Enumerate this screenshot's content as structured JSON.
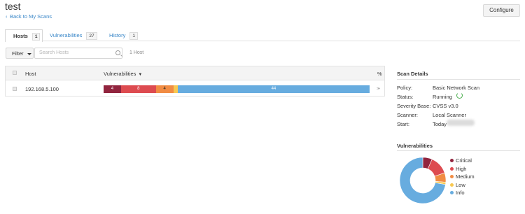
{
  "header": {
    "title": "test",
    "back_link": "Back to My Scans",
    "configure_label": "Configure"
  },
  "tabs": [
    {
      "label": "Hosts",
      "count": "1"
    },
    {
      "label": "Vulnerabilities",
      "count": "27"
    },
    {
      "label": "History",
      "count": "1"
    }
  ],
  "toolbar": {
    "filter_label": "Filter",
    "search_placeholder": "Search Hosts",
    "host_count": "1 Host"
  },
  "table": {
    "columns": {
      "host": "Host",
      "vulnerabilities": "Vulnerabilities",
      "percent": "%"
    },
    "sort_indicator": "▼",
    "rows": [
      {
        "host": "192.168.5.100",
        "action": "≫",
        "counts": [
          {
            "severity": "Critical",
            "value": 4,
            "label": "4",
            "color": "#91243e"
          },
          {
            "severity": "High",
            "value": 8,
            "label": "8",
            "color": "#dd4b50"
          },
          {
            "severity": "Medium",
            "value": 4,
            "label": "4",
            "color": "#f18c43"
          },
          {
            "severity": "Low",
            "value": 1,
            "label": "",
            "color": "#f8c851"
          },
          {
            "severity": "Info",
            "value": 44,
            "label": "44",
            "color": "#67acdf"
          }
        ]
      }
    ]
  },
  "scan_details": {
    "title": "Scan Details",
    "rows": [
      {
        "label": "Policy:",
        "value": "Basic Network Scan"
      },
      {
        "label": "Status:",
        "value": "Running"
      },
      {
        "label": "Severity Base:",
        "value": "CVSS v3.0"
      },
      {
        "label": "Scanner:",
        "value": "Local Scanner"
      },
      {
        "label": "Start:",
        "value": "Today"
      }
    ]
  },
  "vulnerabilities_panel": {
    "title": "Vulnerabilities",
    "legend": [
      {
        "name": "Critical",
        "color": "#91243e"
      },
      {
        "name": "High",
        "color": "#dd4b50"
      },
      {
        "name": "Medium",
        "color": "#f18c43"
      },
      {
        "name": "Low",
        "color": "#f8c851"
      },
      {
        "name": "Info",
        "color": "#67acdf"
      }
    ],
    "slices": [
      4,
      8,
      4,
      1,
      44
    ]
  },
  "icons": {
    "back": "chevron-left-icon",
    "search": "search-icon",
    "status": "refresh-icon",
    "filter": "chevron-down-icon"
  }
}
